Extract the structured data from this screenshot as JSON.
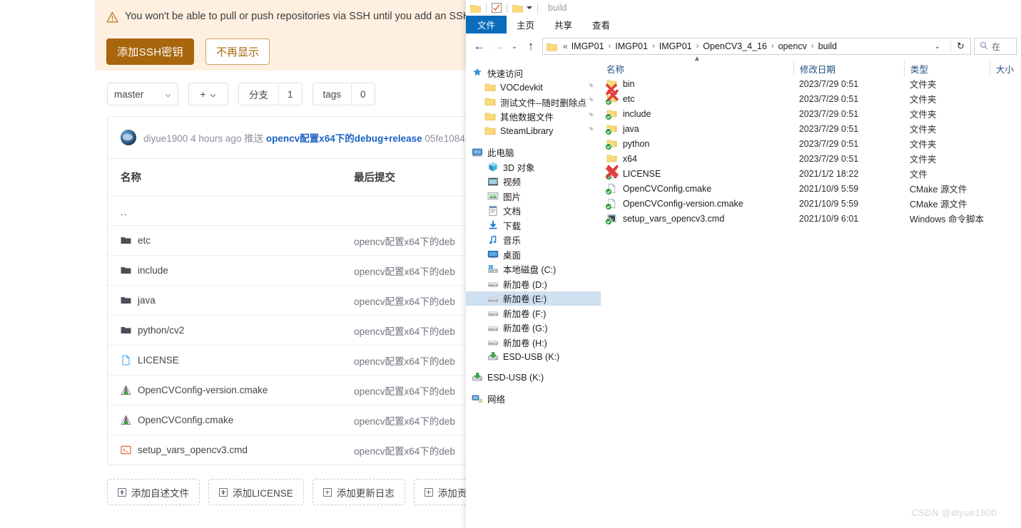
{
  "gitee": {
    "banner": {
      "icon": "warning-triangle-icon",
      "message": "You won't be able to pull or push repositories via SSH until you add an SSH ke",
      "primary_button": "添加SSH密钥",
      "ghost_button": "不再显示"
    },
    "toolbar": {
      "branch_select": "master",
      "plus_label": "+",
      "branches_label": "分支",
      "branches_count": "1",
      "tags_label": "tags",
      "tags_count": "0"
    },
    "commit": {
      "author": "diyue1900",
      "time": "4 hours ago",
      "action": "推送",
      "message": "opencv配置x64下的debug+release",
      "sha": "05fe1084"
    },
    "table": {
      "headers": {
        "name": "名称",
        "last_commit": "最后提交"
      },
      "rows": [
        {
          "icon": "up-dir-icon",
          "name": "..",
          "commit": ""
        },
        {
          "icon": "folder-icon",
          "name": "etc",
          "commit": "opencv配置x64下的deb"
        },
        {
          "icon": "folder-icon",
          "name": "include",
          "commit": "opencv配置x64下的deb"
        },
        {
          "icon": "folder-icon",
          "name": "java",
          "commit": "opencv配置x64下的deb"
        },
        {
          "icon": "folder-icon",
          "name": "python/cv2",
          "commit": "opencv配置x64下的deb"
        },
        {
          "icon": "file-icon",
          "name": "LICENSE",
          "commit": "opencv配置x64下的deb"
        },
        {
          "icon": "cmake-icon",
          "name": "OpenCVConfig-version.cmake",
          "commit": "opencv配置x64下的deb"
        },
        {
          "icon": "cmake-icon",
          "name": "OpenCVConfig.cmake",
          "commit": "opencv配置x64下的deb"
        },
        {
          "icon": "cmd-icon",
          "name": "setup_vars_opencv3.cmd",
          "commit": "opencv配置x64下的deb"
        }
      ]
    },
    "add_buttons": [
      {
        "label": "添加自述文件"
      },
      {
        "label": "添加LICENSE"
      },
      {
        "label": "添加更新日志"
      },
      {
        "label": "添加贡献信息"
      }
    ]
  },
  "explorer": {
    "title": "build",
    "ribbon_tabs": [
      "文件",
      "主页",
      "共享",
      "查看"
    ],
    "address": {
      "overflow": "«",
      "crumbs": [
        "IMGP01",
        "IMGP01",
        "IMGP01",
        "OpenCV3_4_16",
        "opencv",
        "build"
      ],
      "refresh_icon": "refresh-icon",
      "search_placeholder": "在"
    },
    "nav": [
      {
        "label": "快速访问",
        "icon": "quick-access-star-icon",
        "level": 0,
        "pin": false,
        "selected": false
      },
      {
        "label": "VOCdevkit",
        "icon": "folder-icon",
        "level": 1,
        "pin": true,
        "selected": false
      },
      {
        "label": "测试文件--随时删除点",
        "icon": "folder-icon",
        "level": 1,
        "pin": true,
        "selected": false
      },
      {
        "label": "其他数据文件",
        "icon": "folder-icon",
        "level": 1,
        "pin": true,
        "selected": false
      },
      {
        "label": "SteamLibrary",
        "icon": "folder-icon",
        "level": 1,
        "pin": true,
        "selected": false
      },
      {
        "label": "此电脑",
        "icon": "this-pc-icon",
        "level": 0,
        "pin": false,
        "selected": false,
        "gap_before": true
      },
      {
        "label": "3D 对象",
        "icon": "3d-objects-icon",
        "level": 2,
        "pin": false,
        "selected": false
      },
      {
        "label": "视频",
        "icon": "videos-icon",
        "level": 2,
        "pin": false,
        "selected": false
      },
      {
        "label": "图片",
        "icon": "pictures-icon",
        "level": 2,
        "pin": false,
        "selected": false
      },
      {
        "label": "文档",
        "icon": "documents-icon",
        "level": 2,
        "pin": false,
        "selected": false
      },
      {
        "label": "下载",
        "icon": "downloads-icon",
        "level": 2,
        "pin": false,
        "selected": false
      },
      {
        "label": "音乐",
        "icon": "music-icon",
        "level": 2,
        "pin": false,
        "selected": false
      },
      {
        "label": "桌面",
        "icon": "desktop-icon",
        "level": 2,
        "pin": false,
        "selected": false
      },
      {
        "label": "本地磁盘 (C:)",
        "icon": "system-drive-icon",
        "level": 2,
        "pin": false,
        "selected": false
      },
      {
        "label": "新加卷 (D:)",
        "icon": "drive-icon",
        "level": 2,
        "pin": false,
        "selected": false
      },
      {
        "label": "新加卷 (E:)",
        "icon": "drive-icon",
        "level": 2,
        "pin": false,
        "selected": true
      },
      {
        "label": "新加卷 (F:)",
        "icon": "drive-icon",
        "level": 2,
        "pin": false,
        "selected": false
      },
      {
        "label": "新加卷 (G:)",
        "icon": "drive-icon",
        "level": 2,
        "pin": false,
        "selected": false
      },
      {
        "label": "新加卷 (H:)",
        "icon": "drive-icon",
        "level": 2,
        "pin": false,
        "selected": false
      },
      {
        "label": "ESD-USB (K:)",
        "icon": "usb-drive-icon",
        "level": 2,
        "pin": false,
        "selected": false
      },
      {
        "label": "ESD-USB (K:)",
        "icon": "usb-drive-icon",
        "level": 0,
        "pin": false,
        "selected": false,
        "gap_before": true
      },
      {
        "label": "网络",
        "icon": "network-icon",
        "level": 0,
        "pin": false,
        "selected": false,
        "gap_before": true
      }
    ],
    "list": {
      "headers": {
        "name": "名称",
        "date": "修改日期",
        "type": "类型",
        "size": "大小"
      },
      "sort": "ascending",
      "rows": [
        {
          "name": "bin",
          "icon": "folder-icon",
          "overlay": "none",
          "date": "2023/7/29 0:51",
          "type": "文件夹",
          "size": ""
        },
        {
          "name": "etc",
          "icon": "folder-icon",
          "overlay": "sync-ok",
          "date": "2023/7/29 0:51",
          "type": "文件夹",
          "size": ""
        },
        {
          "name": "include",
          "icon": "folder-icon",
          "overlay": "sync-ok",
          "date": "2023/7/29 0:51",
          "type": "文件夹",
          "size": ""
        },
        {
          "name": "java",
          "icon": "folder-icon",
          "overlay": "sync-ok",
          "date": "2023/7/29 0:51",
          "type": "文件夹",
          "size": ""
        },
        {
          "name": "python",
          "icon": "folder-icon",
          "overlay": "sync-ok",
          "date": "2023/7/29 0:51",
          "type": "文件夹",
          "size": ""
        },
        {
          "name": "x64",
          "icon": "folder-icon",
          "overlay": "none",
          "date": "2023/7/29 0:51",
          "type": "文件夹",
          "size": ""
        },
        {
          "name": "LICENSE",
          "icon": "generic-file-icon",
          "overlay": "sync-ok",
          "date": "2021/1/2 18:22",
          "type": "文件",
          "size": ""
        },
        {
          "name": "OpenCVConfig.cmake",
          "icon": "generic-file-icon",
          "overlay": "sync-ok",
          "date": "2021/10/9 5:59",
          "type": "CMake 源文件",
          "size": ""
        },
        {
          "name": "OpenCVConfig-version.cmake",
          "icon": "generic-file-icon",
          "overlay": "sync-ok",
          "date": "2021/10/9 5:59",
          "type": "CMake 源文件",
          "size": ""
        },
        {
          "name": "setup_vars_opencv3.cmd",
          "icon": "cmd-script-icon",
          "overlay": "sync-ok",
          "date": "2021/10/9 6:01",
          "type": "Windows 命令脚本",
          "size": ""
        }
      ]
    }
  },
  "watermark": "CSDN @diyue1900",
  "colors": {
    "banner_bg": "#fdf0e0",
    "banner_accent": "#a8660d",
    "link_blue": "#1b62c4",
    "ribbon_blue": "#0b6cbd",
    "selection_blue": "#cfe0f0",
    "redx": "#e03b3b"
  }
}
